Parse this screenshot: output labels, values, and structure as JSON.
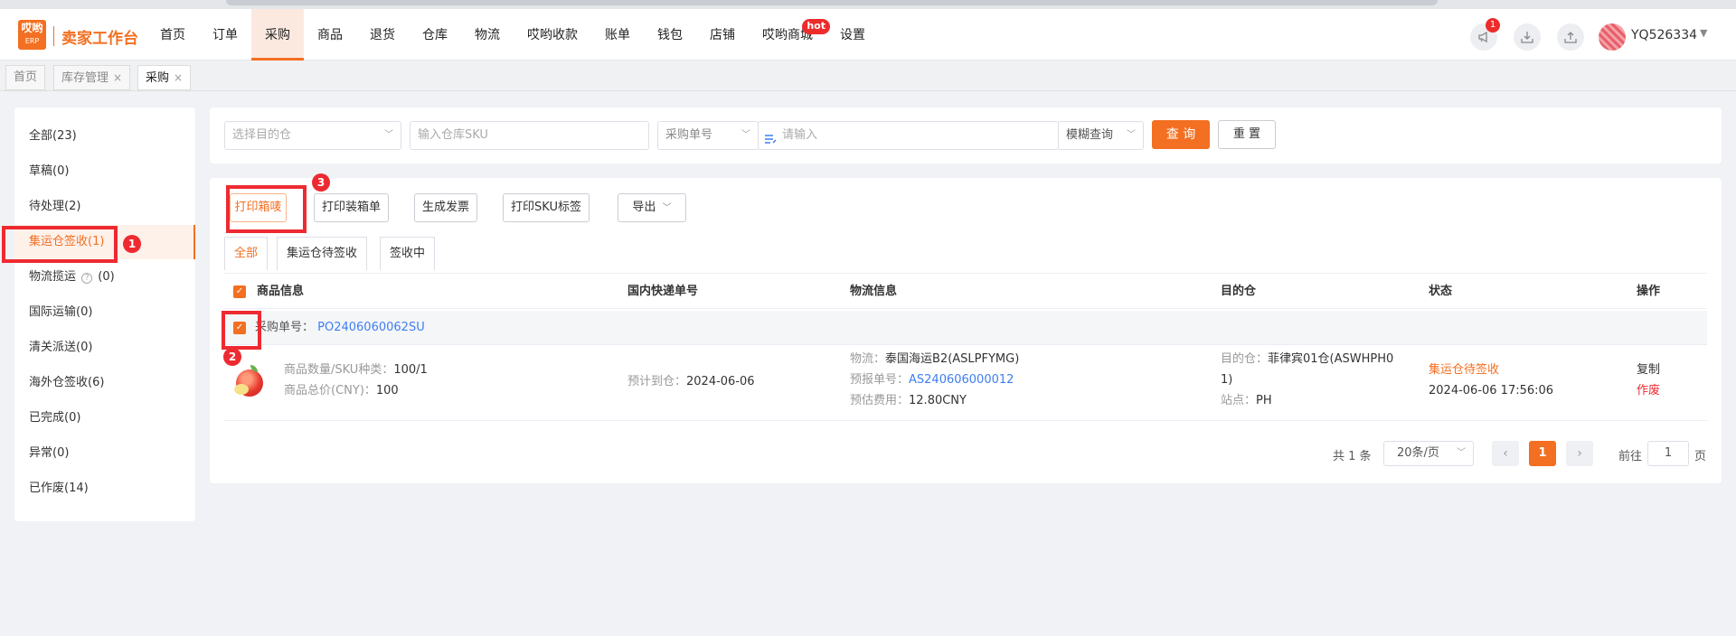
{
  "app": {
    "logo_top": "哎哟",
    "logo_bottom": "ERP",
    "brand": "卖家工作台"
  },
  "nav": {
    "items": [
      "首页",
      "订单",
      "采购",
      "商品",
      "退货",
      "仓库",
      "物流",
      "哎哟收款",
      "账单",
      "钱包",
      "店铺",
      "哎哟商城",
      "设置"
    ],
    "active": "采购",
    "hot_badge": "hot"
  },
  "header": {
    "notice_count": "1",
    "username": "YQ526334"
  },
  "page_tabs": [
    {
      "label": "首页"
    },
    {
      "label": "库存管理",
      "close": "×"
    },
    {
      "label": "采购",
      "close": "×"
    }
  ],
  "sidebar": {
    "items": [
      "全部(23)",
      "草稿(0)",
      "待处理(2)",
      "集运仓签收(1)",
      "物流揽运",
      "国际运输(0)",
      "清关派送(0)",
      "海外仓签收(6)",
      "已完成(0)",
      "异常(0)",
      "已作废(14)"
    ],
    "logistics_count": "(0)",
    "help_glyph": "?",
    "active": "集运仓签收(1)"
  },
  "filters": {
    "warehouse_placeholder": "选择目的仓",
    "sku_placeholder": "输入仓库SKU",
    "order_type": "采购单号",
    "keyword_placeholder": "请输入",
    "match_mode": "模糊查询",
    "query_button": "查 询",
    "reset_button": "重 置"
  },
  "toolbar": {
    "print_label": "打印箱唛",
    "print_packing": "打印装箱单",
    "generate_invoice": "生成发票",
    "print_sku": "打印SKU标签",
    "export": "导出"
  },
  "status_tabs": [
    "全部",
    "集运仓待签收",
    "签收中"
  ],
  "table": {
    "headers": [
      "商品信息",
      "国内快递单号",
      "物流信息",
      "目的仓",
      "状态",
      "操作"
    ],
    "group": {
      "label": "采购单号：",
      "po": "PO2406060062SU"
    },
    "row": {
      "qty_label": "商品数量/SKU种类：",
      "qty_value": "100/1",
      "total_label": "商品总价(CNY)：",
      "total_value": "100",
      "eta_label": "预计到仓：",
      "eta_value": "2024-06-06",
      "logistics_label": "物流：",
      "logistics_value": "泰国海运B2(ASLPFYMG)",
      "forecast_label": "预报单号：",
      "forecast_value": "AS240606000012",
      "fee_label": "预估费用：",
      "fee_value": "12.80CNY",
      "dest_label": "目的仓：",
      "dest_value_line1": "菲律宾01仓(ASWHPH0",
      "dest_value_line2": "1)",
      "site_label": "站点：",
      "site_value": "PH",
      "status": "集运仓待签收",
      "status_time": "2024-06-06 17:56:06",
      "action_copy": "复制",
      "action_void": "作废"
    }
  },
  "pagination": {
    "total": "共 1 条",
    "page_size": "20条/页",
    "current": "1",
    "goto_label": "前往",
    "goto_value": "1",
    "page_unit": "页"
  },
  "annotations": [
    "1",
    "2",
    "3"
  ],
  "colors": {
    "accent": "#f36f21",
    "annotation_red": "#ee2a31",
    "link": "#3f7ef2"
  }
}
